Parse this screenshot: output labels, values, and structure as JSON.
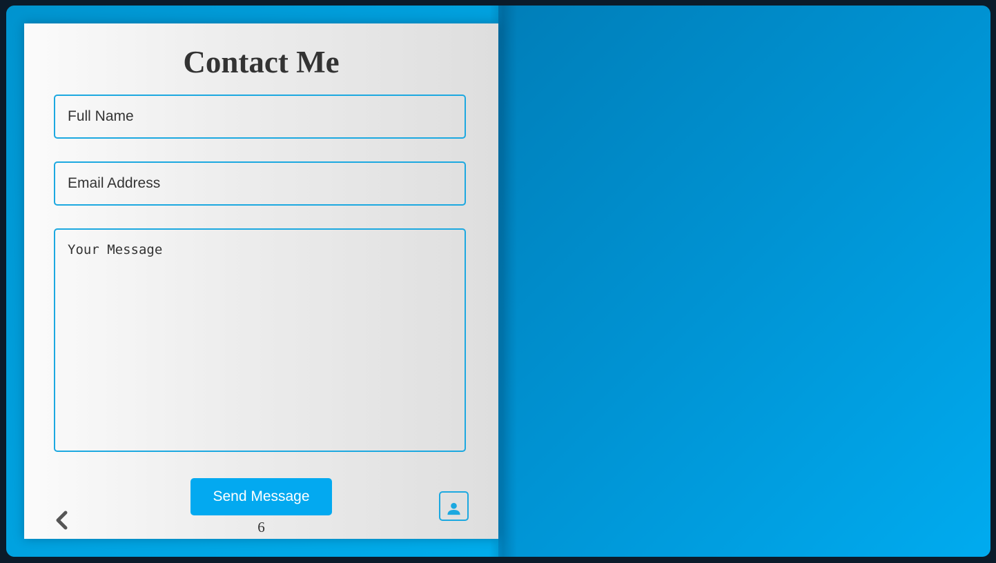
{
  "contact": {
    "title": "Contact Me",
    "name_placeholder": "Full Name",
    "email_placeholder": "Email Address",
    "message_placeholder": "Your Message",
    "send_label": "Send Message",
    "page_number": "6"
  },
  "icons": {
    "back": "chevron-left-icon",
    "profile": "user-icon"
  },
  "colors": {
    "accent": "#03a9f0",
    "border": "#1ba8e0",
    "text": "#333333",
    "background_light": "#00abef",
    "background_dark": "#005f8c"
  }
}
